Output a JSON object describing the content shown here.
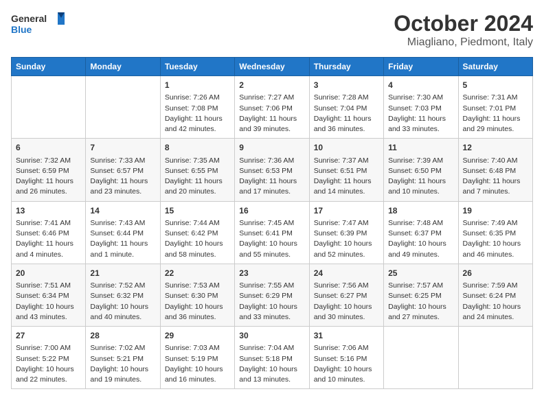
{
  "header": {
    "logo_line1": "General",
    "logo_line2": "Blue",
    "month": "October 2024",
    "location": "Miagliano, Piedmont, Italy"
  },
  "days_of_week": [
    "Sunday",
    "Monday",
    "Tuesday",
    "Wednesday",
    "Thursday",
    "Friday",
    "Saturday"
  ],
  "weeks": [
    [
      {
        "day": "",
        "sunrise": "",
        "sunset": "",
        "daylight": ""
      },
      {
        "day": "",
        "sunrise": "",
        "sunset": "",
        "daylight": ""
      },
      {
        "day": "1",
        "sunrise": "Sunrise: 7:26 AM",
        "sunset": "Sunset: 7:08 PM",
        "daylight": "Daylight: 11 hours and 42 minutes."
      },
      {
        "day": "2",
        "sunrise": "Sunrise: 7:27 AM",
        "sunset": "Sunset: 7:06 PM",
        "daylight": "Daylight: 11 hours and 39 minutes."
      },
      {
        "day": "3",
        "sunrise": "Sunrise: 7:28 AM",
        "sunset": "Sunset: 7:04 PM",
        "daylight": "Daylight: 11 hours and 36 minutes."
      },
      {
        "day": "4",
        "sunrise": "Sunrise: 7:30 AM",
        "sunset": "Sunset: 7:03 PM",
        "daylight": "Daylight: 11 hours and 33 minutes."
      },
      {
        "day": "5",
        "sunrise": "Sunrise: 7:31 AM",
        "sunset": "Sunset: 7:01 PM",
        "daylight": "Daylight: 11 hours and 29 minutes."
      }
    ],
    [
      {
        "day": "6",
        "sunrise": "Sunrise: 7:32 AM",
        "sunset": "Sunset: 6:59 PM",
        "daylight": "Daylight: 11 hours and 26 minutes."
      },
      {
        "day": "7",
        "sunrise": "Sunrise: 7:33 AM",
        "sunset": "Sunset: 6:57 PM",
        "daylight": "Daylight: 11 hours and 23 minutes."
      },
      {
        "day": "8",
        "sunrise": "Sunrise: 7:35 AM",
        "sunset": "Sunset: 6:55 PM",
        "daylight": "Daylight: 11 hours and 20 minutes."
      },
      {
        "day": "9",
        "sunrise": "Sunrise: 7:36 AM",
        "sunset": "Sunset: 6:53 PM",
        "daylight": "Daylight: 11 hours and 17 minutes."
      },
      {
        "day": "10",
        "sunrise": "Sunrise: 7:37 AM",
        "sunset": "Sunset: 6:51 PM",
        "daylight": "Daylight: 11 hours and 14 minutes."
      },
      {
        "day": "11",
        "sunrise": "Sunrise: 7:39 AM",
        "sunset": "Sunset: 6:50 PM",
        "daylight": "Daylight: 11 hours and 10 minutes."
      },
      {
        "day": "12",
        "sunrise": "Sunrise: 7:40 AM",
        "sunset": "Sunset: 6:48 PM",
        "daylight": "Daylight: 11 hours and 7 minutes."
      }
    ],
    [
      {
        "day": "13",
        "sunrise": "Sunrise: 7:41 AM",
        "sunset": "Sunset: 6:46 PM",
        "daylight": "Daylight: 11 hours and 4 minutes."
      },
      {
        "day": "14",
        "sunrise": "Sunrise: 7:43 AM",
        "sunset": "Sunset: 6:44 PM",
        "daylight": "Daylight: 11 hours and 1 minute."
      },
      {
        "day": "15",
        "sunrise": "Sunrise: 7:44 AM",
        "sunset": "Sunset: 6:42 PM",
        "daylight": "Daylight: 10 hours and 58 minutes."
      },
      {
        "day": "16",
        "sunrise": "Sunrise: 7:45 AM",
        "sunset": "Sunset: 6:41 PM",
        "daylight": "Daylight: 10 hours and 55 minutes."
      },
      {
        "day": "17",
        "sunrise": "Sunrise: 7:47 AM",
        "sunset": "Sunset: 6:39 PM",
        "daylight": "Daylight: 10 hours and 52 minutes."
      },
      {
        "day": "18",
        "sunrise": "Sunrise: 7:48 AM",
        "sunset": "Sunset: 6:37 PM",
        "daylight": "Daylight: 10 hours and 49 minutes."
      },
      {
        "day": "19",
        "sunrise": "Sunrise: 7:49 AM",
        "sunset": "Sunset: 6:35 PM",
        "daylight": "Daylight: 10 hours and 46 minutes."
      }
    ],
    [
      {
        "day": "20",
        "sunrise": "Sunrise: 7:51 AM",
        "sunset": "Sunset: 6:34 PM",
        "daylight": "Daylight: 10 hours and 43 minutes."
      },
      {
        "day": "21",
        "sunrise": "Sunrise: 7:52 AM",
        "sunset": "Sunset: 6:32 PM",
        "daylight": "Daylight: 10 hours and 40 minutes."
      },
      {
        "day": "22",
        "sunrise": "Sunrise: 7:53 AM",
        "sunset": "Sunset: 6:30 PM",
        "daylight": "Daylight: 10 hours and 36 minutes."
      },
      {
        "day": "23",
        "sunrise": "Sunrise: 7:55 AM",
        "sunset": "Sunset: 6:29 PM",
        "daylight": "Daylight: 10 hours and 33 minutes."
      },
      {
        "day": "24",
        "sunrise": "Sunrise: 7:56 AM",
        "sunset": "Sunset: 6:27 PM",
        "daylight": "Daylight: 10 hours and 30 minutes."
      },
      {
        "day": "25",
        "sunrise": "Sunrise: 7:57 AM",
        "sunset": "Sunset: 6:25 PM",
        "daylight": "Daylight: 10 hours and 27 minutes."
      },
      {
        "day": "26",
        "sunrise": "Sunrise: 7:59 AM",
        "sunset": "Sunset: 6:24 PM",
        "daylight": "Daylight: 10 hours and 24 minutes."
      }
    ],
    [
      {
        "day": "27",
        "sunrise": "Sunrise: 7:00 AM",
        "sunset": "Sunset: 5:22 PM",
        "daylight": "Daylight: 10 hours and 22 minutes."
      },
      {
        "day": "28",
        "sunrise": "Sunrise: 7:02 AM",
        "sunset": "Sunset: 5:21 PM",
        "daylight": "Daylight: 10 hours and 19 minutes."
      },
      {
        "day": "29",
        "sunrise": "Sunrise: 7:03 AM",
        "sunset": "Sunset: 5:19 PM",
        "daylight": "Daylight: 10 hours and 16 minutes."
      },
      {
        "day": "30",
        "sunrise": "Sunrise: 7:04 AM",
        "sunset": "Sunset: 5:18 PM",
        "daylight": "Daylight: 10 hours and 13 minutes."
      },
      {
        "day": "31",
        "sunrise": "Sunrise: 7:06 AM",
        "sunset": "Sunset: 5:16 PM",
        "daylight": "Daylight: 10 hours and 10 minutes."
      },
      {
        "day": "",
        "sunrise": "",
        "sunset": "",
        "daylight": ""
      },
      {
        "day": "",
        "sunrise": "",
        "sunset": "",
        "daylight": ""
      }
    ]
  ]
}
